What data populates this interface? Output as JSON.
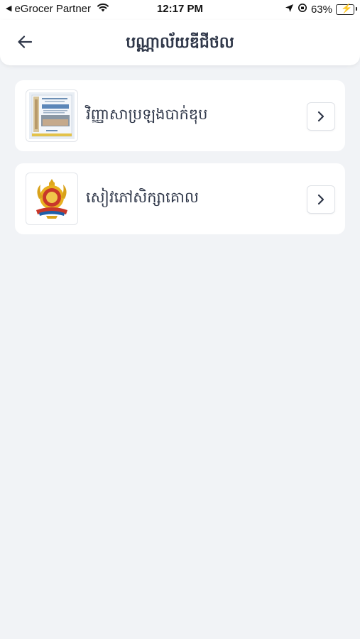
{
  "status_bar": {
    "carrier": "eGrocer Partner",
    "time": "12:17 PM",
    "battery_percent": "63%"
  },
  "header": {
    "title": "បណ្ណាល័យឌីជីថល"
  },
  "items": [
    {
      "label": "វិញ្ញាសាប្រឡងបាក់ឌុប",
      "icon": "exam-book-cover"
    },
    {
      "label": "សៀវភៅសិក្សាគោល",
      "icon": "ministry-emblem"
    }
  ],
  "colors": {
    "background": "#f1f3f6",
    "card": "#ffffff",
    "text": "#30384a",
    "battery": "#34c759"
  }
}
